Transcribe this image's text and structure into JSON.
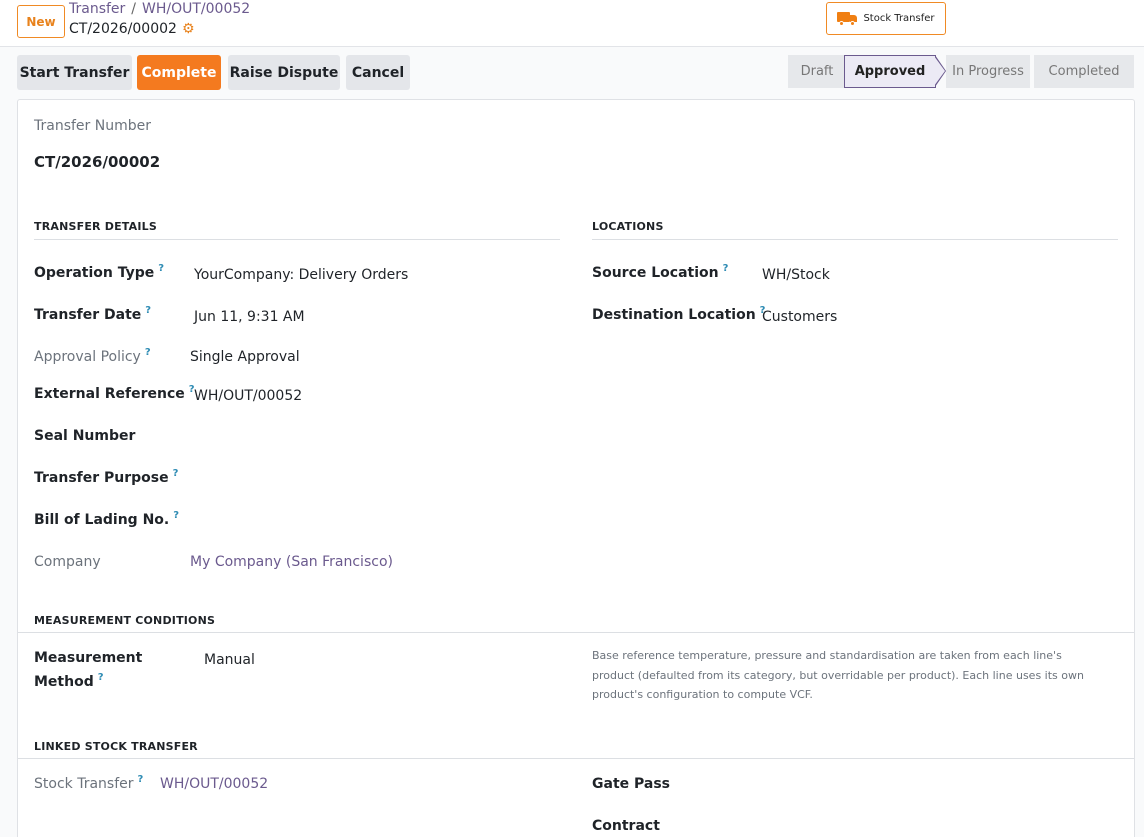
{
  "control_panel": {
    "new_label": "New",
    "breadcrumb": [
      "Transfer",
      "WH/OUT/00052"
    ],
    "breadcrumb_sep": "/",
    "record_name": "CT/2026/00002",
    "stock_transfer_label": "Stock Transfer"
  },
  "actions": {
    "start_transfer": "Start Transfer",
    "complete": "Complete",
    "raise_dispute": "Raise Dispute",
    "cancel": "Cancel"
  },
  "statusbar": {
    "states": [
      "Draft",
      "Approved",
      "In Progress",
      "Completed"
    ],
    "active": "Approved"
  },
  "form": {
    "transfer_number_label": "Transfer Number",
    "transfer_number": "CT/2026/00002",
    "transfer_details": {
      "title": "TRANSFER DETAILS",
      "operation_type_label": "Operation Type",
      "operation_type": "YourCompany: Delivery Orders",
      "transfer_date_label": "Transfer Date",
      "transfer_date": "Jun 11, 9:31 AM",
      "approval_policy_label": "Approval Policy",
      "approval_policy": "Single Approval",
      "external_reference_label": "External Reference",
      "external_reference": "WH/OUT/00052",
      "seal_number_label": "Seal Number",
      "transfer_purpose_label": "Transfer Purpose",
      "bill_of_lading_label": "Bill of Lading No.",
      "company_label": "Company",
      "company": "My Company (San Francisco)"
    },
    "locations": {
      "title": "LOCATIONS",
      "source_label": "Source Location",
      "source": "WH/Stock",
      "destination_label": "Destination Location",
      "destination": "Customers"
    },
    "measurement": {
      "title": "MEASUREMENT CONDITIONS",
      "method_label_1": "Measurement",
      "method_label_2": "Method",
      "method": "Manual",
      "note": "Base reference temperature, pressure and standardisation are taken from each line's product (defaulted from its category, but overridable per product). Each line uses its own product's configuration to compute VCF."
    },
    "linked": {
      "title": "LINKED STOCK TRANSFER",
      "stock_transfer_label": "Stock Transfer",
      "stock_transfer": "WH/OUT/00052",
      "gate_pass_label": "Gate Pass",
      "contract_label": "Contract"
    },
    "help_mark": "?"
  },
  "colors": {
    "accent_orange": "#f47a1f",
    "link_purple": "#6b5a8e",
    "help_blue": "#2f8cb4"
  }
}
